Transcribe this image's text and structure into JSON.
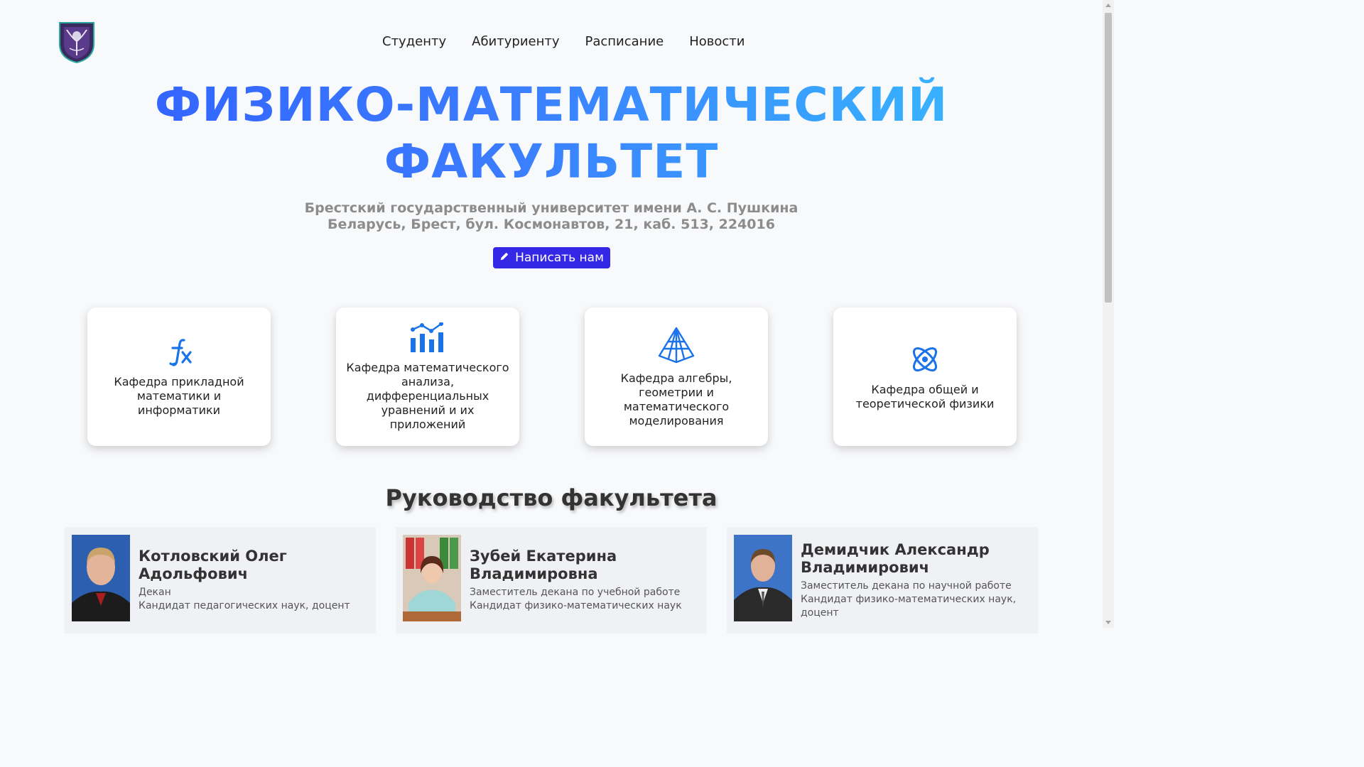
{
  "nav": {
    "items": [
      {
        "label": "Студенту"
      },
      {
        "label": "Абитуриенту"
      },
      {
        "label": "Расписание"
      },
      {
        "label": "Новости"
      }
    ]
  },
  "hero": {
    "title_line1": "ФИЗИКО-МАТЕМАТИЧЕСКИЙ",
    "title_line2": "ФАКУЛЬТЕТ",
    "subtitle_line1": "Брестский государственный университет имени А. С. Пушкина",
    "subtitle_line2": "Беларусь, Брест, бул. Космонавтов, 21, каб. 513, 224016",
    "button_label": "Написать нам",
    "button_icon": "pencil-icon"
  },
  "departments": [
    {
      "label": "Кафедра прикладной математики и информатики",
      "icon": "fx-icon"
    },
    {
      "label": "Кафедра математического анализа, дифференциальных уравнений и их приложений",
      "icon": "chart-icon"
    },
    {
      "label": "Кафедра алгебры, геометрии и математического моделирования",
      "icon": "pyramid-icon"
    },
    {
      "label": "Кафедра общей и теоретической физики",
      "icon": "atom-icon"
    }
  ],
  "leadership": {
    "title": "Руководство факультета",
    "people": [
      {
        "name": "Котловский Олег Адольфович",
        "role": "Декан",
        "degree": "Кандидат педагогических наук, доцент"
      },
      {
        "name": "Зубей Екатерина Владимировна",
        "role": "Заместитель декана по учебной работе",
        "degree": "Кандидат физико-математических наук"
      },
      {
        "name": "Демидчик Александр Владимирович",
        "role": "Заместитель декана по научной работе",
        "degree": "Кандидат физико-математических наук, доцент"
      }
    ]
  },
  "colors": {
    "accent": "#3527e6",
    "icon": "#1a73e8",
    "title_gradient_start": "#2f5bff",
    "title_gradient_end": "#36c4ff"
  }
}
